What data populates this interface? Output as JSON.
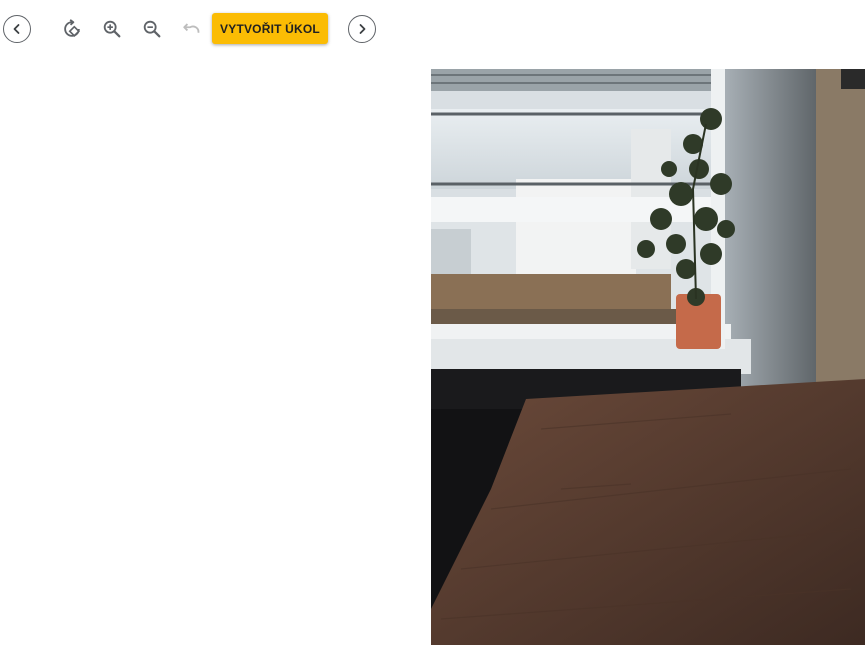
{
  "toolbar": {
    "prev_icon": "chevron-left-icon",
    "rotate_icon": "rotate-icon",
    "zoom_in_icon": "zoom-in-icon",
    "zoom_out_icon": "zoom-out-icon",
    "undo_icon": "undo-icon",
    "create_task_label": "VYTVOŘIT ÚKOL",
    "next_icon": "chevron-right-icon"
  },
  "colors": {
    "accent": "#fbbc04",
    "icon": "#5f6368",
    "icon_disabled": "#bdbdbd"
  },
  "viewer": {
    "image_content": "photo-window-plant-wooden-table"
  }
}
